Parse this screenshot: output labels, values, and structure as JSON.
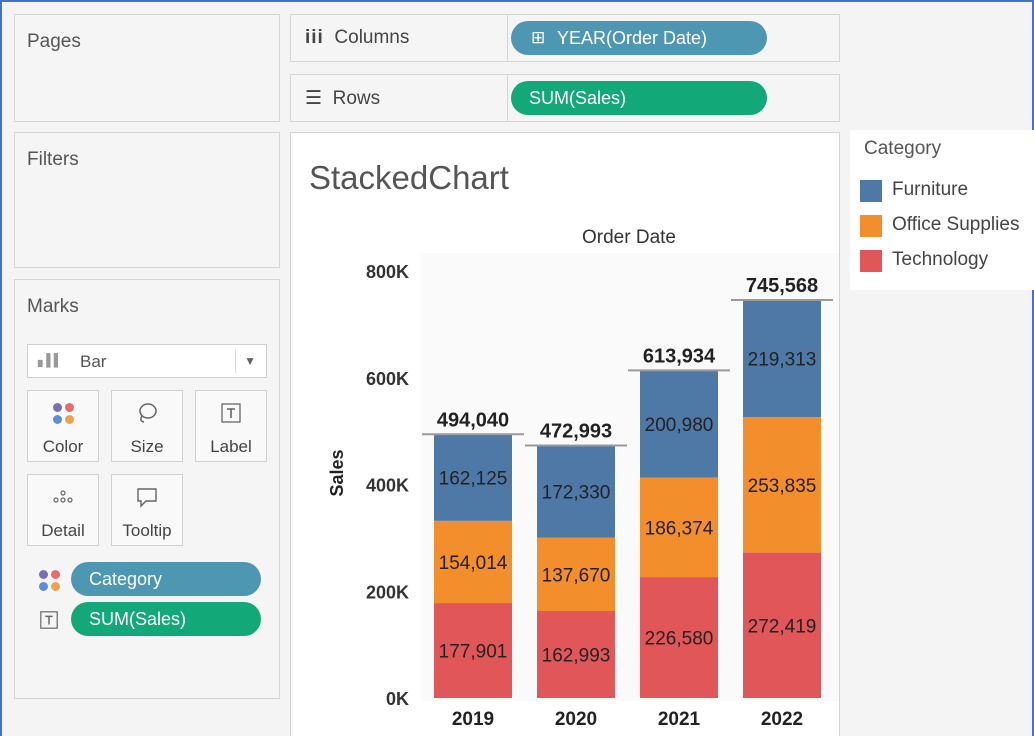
{
  "cards": {
    "pages": "Pages",
    "filters": "Filters",
    "marks": "Marks"
  },
  "marks_card": {
    "mark_type": "Bar",
    "buttons": [
      {
        "label": "Color",
        "icon": "color-dots-icon"
      },
      {
        "label": "Size",
        "icon": "size-lasso-icon"
      },
      {
        "label": "Label",
        "icon": "label-text-icon"
      },
      {
        "label": "Detail",
        "icon": "detail-dots-icon"
      },
      {
        "label": "Tooltip",
        "icon": "tooltip-bubble-icon"
      }
    ],
    "fields": [
      {
        "label": "Category",
        "icon": "color-dots-icon",
        "pill_color": "#4e97b3"
      },
      {
        "label": "SUM(Sales)",
        "icon": "label-text-icon",
        "pill_color": "#13a878"
      }
    ]
  },
  "shelves": {
    "columns_label": "Columns",
    "columns_pill": "YEAR(Order Date)",
    "rows_label": "Rows",
    "rows_pill": "SUM(Sales)"
  },
  "viz": {
    "title": "StackedChart"
  },
  "legend": {
    "title": "Category",
    "items": [
      {
        "label": "Furniture",
        "color": "#4e79a7"
      },
      {
        "label": "Office Supplies",
        "color": "#f28e2b"
      },
      {
        "label": "Technology",
        "color": "#e15759"
      }
    ]
  },
  "chart_data": {
    "type": "bar",
    "stacked": true,
    "title": "Order Date",
    "xlabel": "",
    "ylabel": "Sales",
    "categories": [
      "2019",
      "2020",
      "2021",
      "2022"
    ],
    "ylim": [
      0,
      800000
    ],
    "yticks": [
      "0K",
      "200K",
      "400K",
      "600K",
      "800K"
    ],
    "ytick_values": [
      0,
      200000,
      400000,
      600000,
      800000
    ],
    "grid": false,
    "series": [
      {
        "name": "Technology",
        "color": "#e15759",
        "values": [
          177901,
          162993,
          226580,
          272419
        ],
        "labels": [
          "177,901",
          "162,993",
          "226,580",
          "272,419"
        ]
      },
      {
        "name": "Office Supplies",
        "color": "#f28e2b",
        "values": [
          154014,
          137670,
          186374,
          253835
        ],
        "labels": [
          "154,014",
          "137,670",
          "186,374",
          "253,835"
        ]
      },
      {
        "name": "Furniture",
        "color": "#4e79a7",
        "values": [
          162125,
          172330,
          200980,
          219313
        ],
        "labels": [
          "162,125",
          "172,330",
          "200,980",
          "219,313"
        ]
      }
    ],
    "totals": [
      494040,
      472993,
      613934,
      745568
    ],
    "total_labels": [
      "494,040",
      "472,993",
      "613,934",
      "745,568"
    ]
  }
}
